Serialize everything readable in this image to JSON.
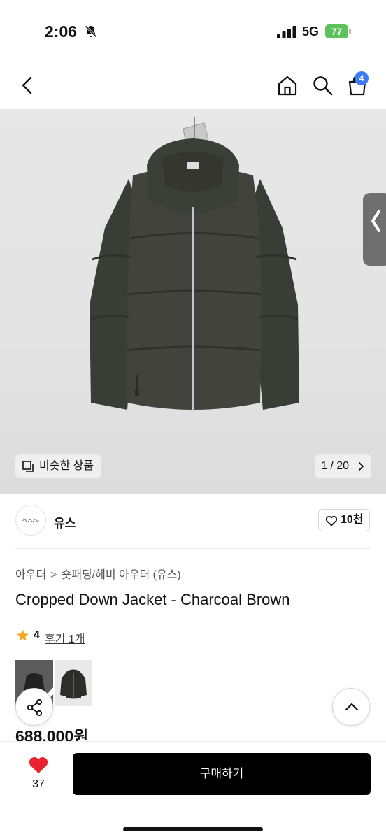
{
  "status_bar": {
    "time": "2:06",
    "network": "5G",
    "battery": "77"
  },
  "nav": {
    "cart_badge": "4",
    "icons": [
      "back-icon",
      "home-icon",
      "search-icon",
      "shopping-bag-icon"
    ]
  },
  "gallery": {
    "similar_label": "비슷한 상품",
    "counter": "1 / 20"
  },
  "brand": {
    "name": "유스",
    "likes": "10천"
  },
  "product": {
    "breadcrumb": [
      "아우터",
      "숏패딩/헤비 아우터 (유스)"
    ],
    "title": "Cropped Down Jacket - Charcoal Brown",
    "rating": "4",
    "review_label": "후기 1개",
    "price": "688,000원"
  },
  "bottom_bar": {
    "wish_count": "37",
    "buy_label": "구매하기"
  },
  "colors": {
    "accent_blue": "#3b7cf5",
    "heart_red": "#e8232f",
    "star": "#f5a623",
    "battery_green": "#5bc35a",
    "jacket": "#3f413b"
  }
}
